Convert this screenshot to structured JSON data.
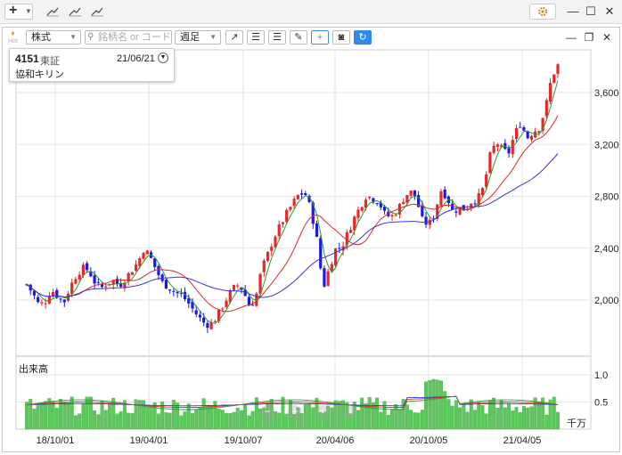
{
  "toolbar": {
    "market_select": "株式",
    "search_placeholder": "銘柄名 or コード",
    "period_select": "週足"
  },
  "stock": {
    "code": "4151",
    "market": "東証",
    "date": "21/06/21",
    "name": "協和キリン"
  },
  "panel_badge": "Hot",
  "volume_label": "出来高",
  "volume_unit": "千万",
  "chart_data": {
    "type": "candlestick",
    "price_axis": {
      "ticks": [
        "3,600",
        "3,200",
        "2,800",
        "2,400",
        "2,000"
      ]
    },
    "volume_axis": {
      "ticks": [
        "1.0",
        "0.5"
      ],
      "unit": "千万"
    },
    "x_ticks": [
      "18/10/01",
      "19/04/01",
      "19/10/07",
      "20/04/06",
      "20/10/05",
      "21/04/05"
    ],
    "up_color": "#e8262b",
    "down_color": "#1a1ae0",
    "ma_colors": {
      "short": "#2b9b2b",
      "medium": "#e0282a",
      "long": "#3a34d8"
    },
    "volume_color": "#5bc85b",
    "price_path": [
      2120,
      2050,
      1960,
      1990,
      2080,
      2030,
      1980,
      2100,
      2190,
      2250,
      2230,
      2140,
      2090,
      2130,
      2150,
      2110,
      2170,
      2230,
      2290,
      2400,
      2330,
      2230,
      2130,
      2100,
      2060,
      2040,
      1990,
      1920,
      1860,
      1810,
      1820,
      1890,
      1980,
      2060,
      2120,
      2080,
      1960,
      2000,
      2230,
      2350,
      2480,
      2570,
      2660,
      2740,
      2810,
      2830,
      2700,
      2460,
      2090,
      2250,
      2390,
      2410,
      2520,
      2630,
      2720,
      2810,
      2780,
      2760,
      2660,
      2640,
      2690,
      2780,
      2840,
      2800,
      2620,
      2580,
      2650,
      2850,
      2800,
      2680,
      2710,
      2700,
      2760,
      2780,
      2870,
      3110,
      3220,
      3160,
      3130,
      3280,
      3370,
      3250,
      3300,
      3330,
      3480,
      3720,
      3810
    ]
  }
}
